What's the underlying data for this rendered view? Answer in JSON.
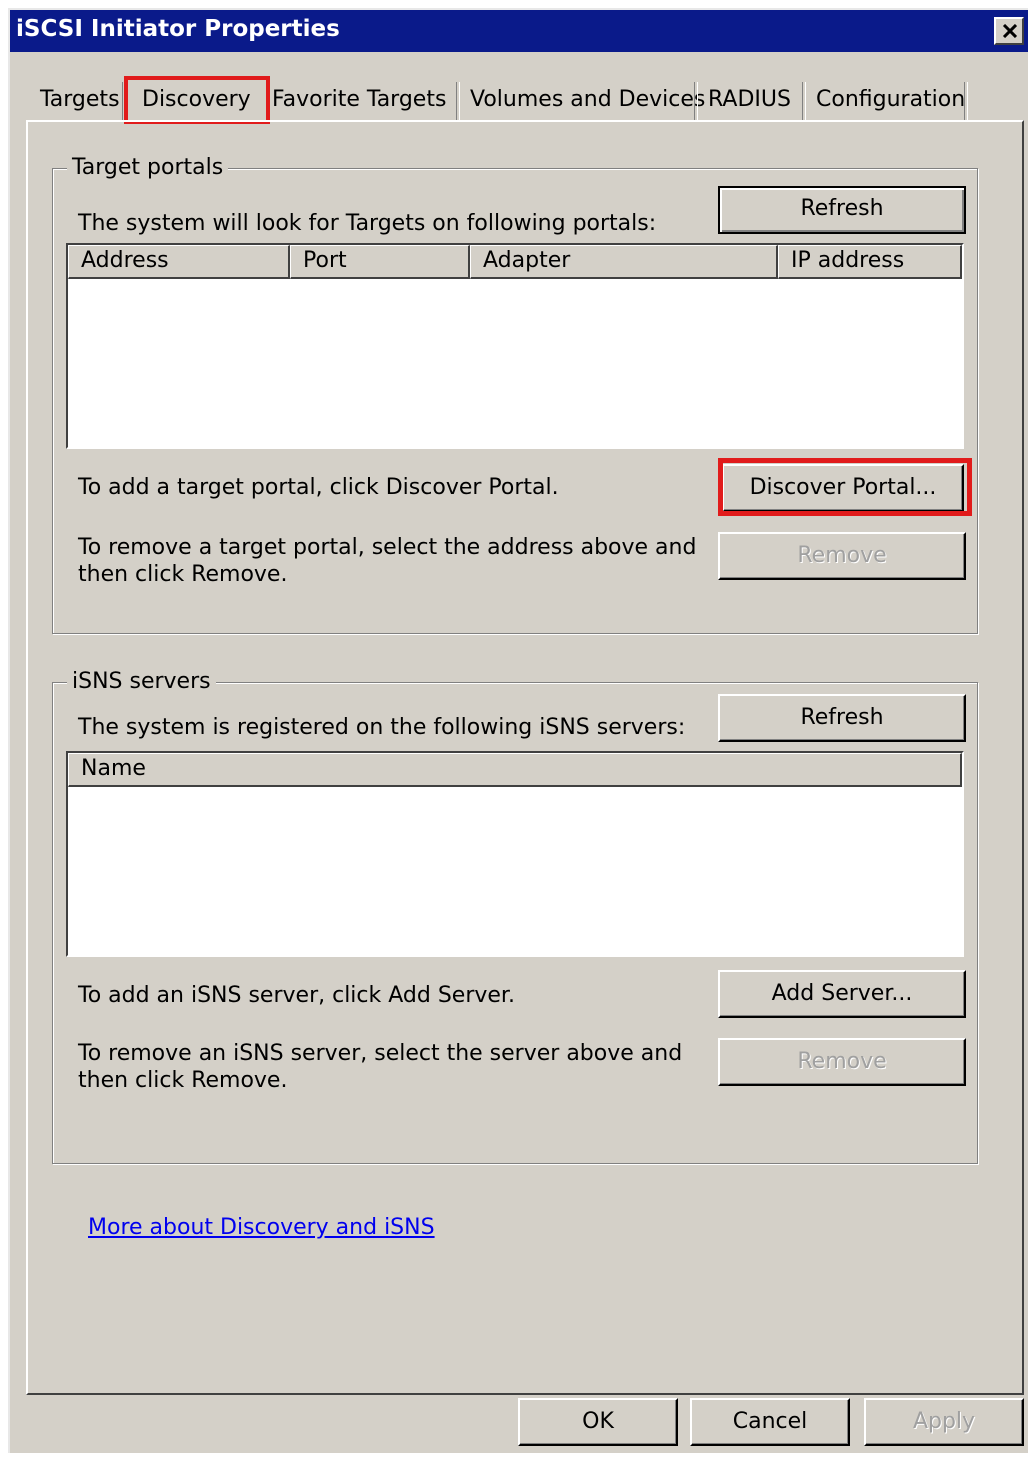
{
  "window": {
    "title": "iSCSI Initiator Properties"
  },
  "tabs": [
    {
      "label": "Targets"
    },
    {
      "label": "Discovery"
    },
    {
      "label": "Favorite Targets"
    },
    {
      "label": "Volumes and Devices"
    },
    {
      "label": "RADIUS"
    },
    {
      "label": "Configuration"
    }
  ],
  "active_tab": "Discovery",
  "target_portals": {
    "group_title": "Target portals",
    "description": "The system will look for Targets on following portals:",
    "refresh_label": "Refresh",
    "columns": [
      "Address",
      "Port",
      "Adapter",
      "IP address"
    ],
    "rows": [],
    "add_hint": "To add a target portal, click Discover Portal.",
    "discover_label": "Discover Portal...",
    "remove_hint_line1": "To remove a target portal, select the address above and",
    "remove_hint_line2": "then click Remove.",
    "remove_label": "Remove"
  },
  "isns_servers": {
    "group_title": "iSNS servers",
    "description": "The system is registered on the following iSNS servers:",
    "refresh_label": "Refresh",
    "columns": [
      "Name"
    ],
    "rows": [],
    "add_hint": "To add an iSNS server, click Add Server.",
    "add_label": "Add Server...",
    "remove_hint_line1": "To remove an iSNS server, select the server above and",
    "remove_hint_line2": "then click Remove.",
    "remove_label": "Remove"
  },
  "help_link": "More about Discovery and iSNS",
  "footer": {
    "ok_label": "OK",
    "cancel_label": "Cancel",
    "apply_label": "Apply"
  },
  "colors": {
    "highlight": "#e11b1b",
    "titlebar": "#0a1a8a",
    "face": "#d4d0c8",
    "link": "#0000ee"
  }
}
